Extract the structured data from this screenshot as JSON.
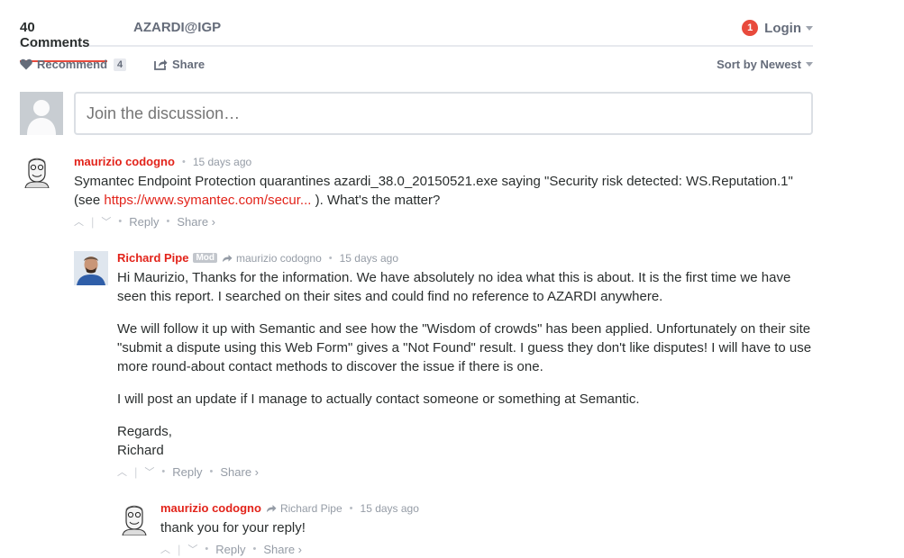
{
  "nav": {
    "comments_tab": "40 Comments",
    "site_tab": "AZARDI@IGP",
    "login_label": "Login",
    "notification_count": "1"
  },
  "actions": {
    "recommend_label": "Recommend",
    "recommend_count": "4",
    "share_label": "Share",
    "sort_label": "Sort by Newest"
  },
  "composer": {
    "placeholder": "Join the discussion…"
  },
  "comments": [
    {
      "author": "maurizio codogno",
      "time": "15 days ago",
      "text_before_link": "Symantec Endpoint Protection quarantines azardi_38.0_20150521.exe saying \"Security risk detected: WS.Reputation.1\" (see",
      "link_text": "https://www.symantec.com/secur...",
      "text_after_link": "). What's the matter?",
      "reply_label": "Reply",
      "share_label": "Share ›"
    },
    {
      "author": "Richard Pipe",
      "badge": "Mod",
      "in_reply_to": "maurizio codogno",
      "time": "15 days ago",
      "paragraphs": [
        "Hi Maurizio, Thanks for the information. We have absolutely no idea what this is about. It is the first time we have seen this report. I searched on their sites and could find no reference to AZARDI anywhere.",
        "We will follow it up with Semantic and see how the \"Wisdom of crowds\" has been applied. Unfortunately on their site \"submit a dispute using this Web Form\" gives a \"Not Found\" result. I guess they don't like disputes! I will have to use more round-about contact methods to discover the issue if there is one.",
        "I will post an update if I manage to actually contact someone or something at Semantic.",
        "Regards,",
        "Richard"
      ],
      "reply_label": "Reply",
      "share_label": "Share ›"
    },
    {
      "author": "maurizio codogno",
      "in_reply_to": "Richard Pipe",
      "time": "15 days ago",
      "text": "thank you for your reply!",
      "reply_label": "Reply",
      "share_label": "Share ›"
    }
  ],
  "icons": {
    "vote_up": "chevron-up-icon",
    "vote_down": "chevron-down-icon",
    "heart": "heart-icon",
    "share": "share-icon",
    "reply_arrow": "reply-arrow-icon"
  },
  "colors": {
    "accent": "#e2231a",
    "tab_underline": "#e84a3c",
    "muted": "#959ca6"
  }
}
